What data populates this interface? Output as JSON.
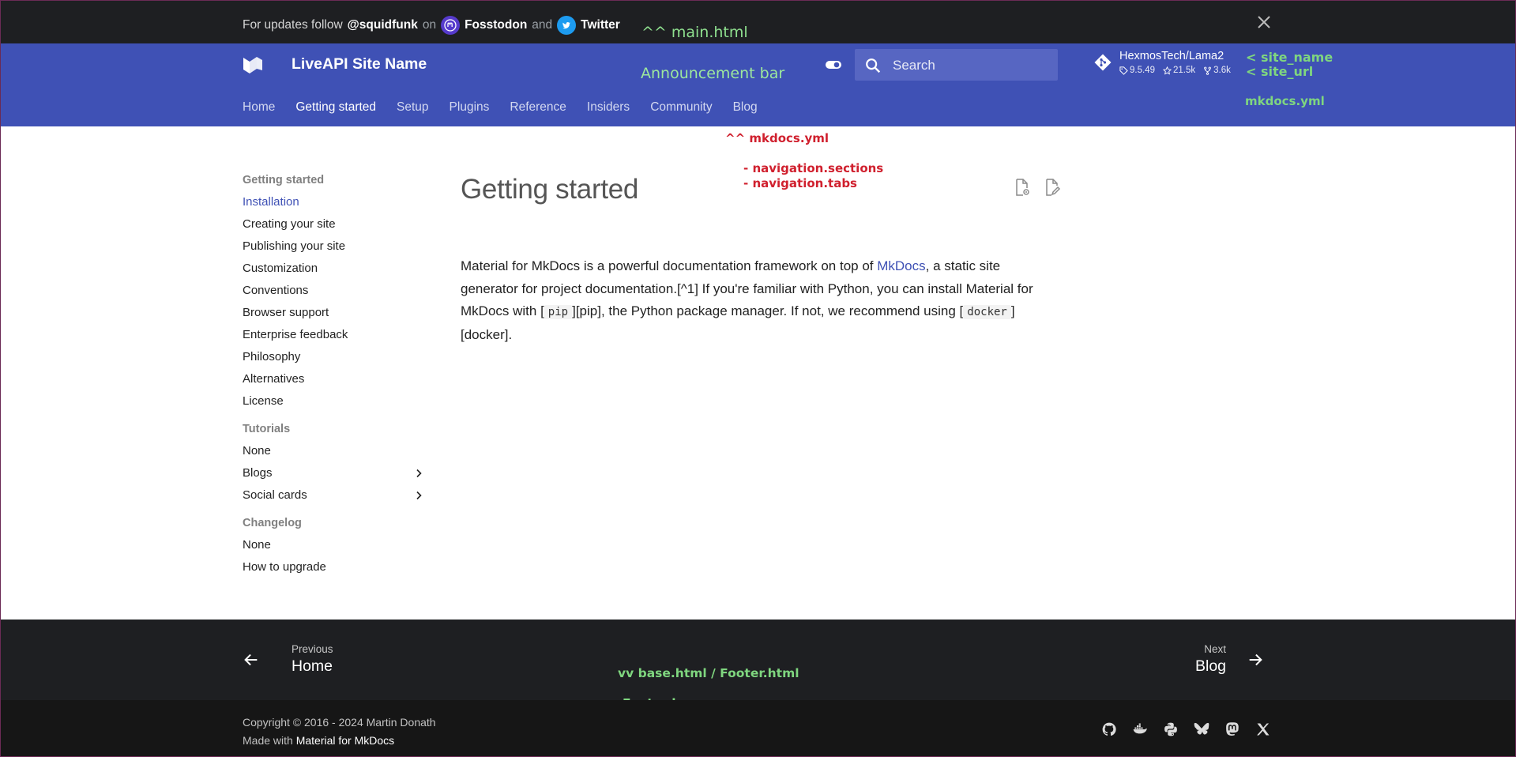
{
  "announcement": {
    "prefix": "For updates follow",
    "handle": "@squidfunk",
    "on": "on",
    "fosstodon": "Fosstodon",
    "and": "and",
    "twitter": "Twitter"
  },
  "header": {
    "site_name": "LiveAPI Site Name",
    "search_placeholder": "Search",
    "repo": {
      "name": "HexmosTech/Lama2",
      "version": "9.5.49",
      "stars": "21.5k",
      "forks": "3.6k"
    },
    "tabs": [
      {
        "label": "Home"
      },
      {
        "label": "Getting started"
      },
      {
        "label": "Setup"
      },
      {
        "label": "Plugins"
      },
      {
        "label": "Reference"
      },
      {
        "label": "Insiders"
      },
      {
        "label": "Community"
      },
      {
        "label": "Blog"
      }
    ],
    "active_tab": "Getting started"
  },
  "annotations": {
    "main_html": "^^ main.html",
    "announcement_bar": "Announcement bar",
    "site_name": "< site_name",
    "site_url": "< site_url",
    "mkdocs_yml_right": "mkdocs.yml",
    "mkdocs_yml_mid": "^^ mkdocs.yml",
    "nav_sections": "- navigation.sections",
    "nav_tabs": "- navigation.tabs",
    "base_footer": "vv base.html / Footer.html",
    "footer_bar": "Footer bar"
  },
  "sidebar": {
    "section1": "Getting started",
    "items1": [
      "Installation",
      "Creating your site",
      "Publishing your site",
      "Customization",
      "Conventions",
      "Browser support",
      "Enterprise feedback",
      "Philosophy",
      "Alternatives",
      "License"
    ],
    "section2": "Tutorials",
    "items2": [
      "None",
      "Blogs",
      "Social cards"
    ],
    "section3": "Changelog",
    "items3": [
      "None",
      "How to upgrade"
    ]
  },
  "main": {
    "title": "Getting started",
    "p_text1": "Material for MkDocs is a powerful documentation framework on top of ",
    "p_link": "MkDocs",
    "p_text2": ", a static site generator for project documentation.[^1] If you're familiar with Python, you can install Material for MkDocs with [",
    "p_code1": "pip",
    "p_text3": "][pip], the Python package manager. If not, we recommend using [",
    "p_code2": "docker",
    "p_text4": "][docker]."
  },
  "footer": {
    "prev_caption": "Previous",
    "prev_title": "Home",
    "next_caption": "Next",
    "next_title": "Blog",
    "copyright": "Copyright © 2016 - 2024 Martin Donath",
    "made_with": "Made with",
    "made_with_link": "Material for MkDocs"
  },
  "colors": {
    "primary": "#3f51b5",
    "announcement_bg": "#1e1f22",
    "footer_bg": "#1e1f22",
    "footer_meta_bg": "#161616",
    "annotation_green": "#7fd67f",
    "annotation_red": "#d0202e"
  },
  "icons": {
    "social": [
      "github-icon",
      "docker-icon",
      "python-icon",
      "bluesky-icon",
      "mastodon-icon",
      "x-icon"
    ]
  }
}
